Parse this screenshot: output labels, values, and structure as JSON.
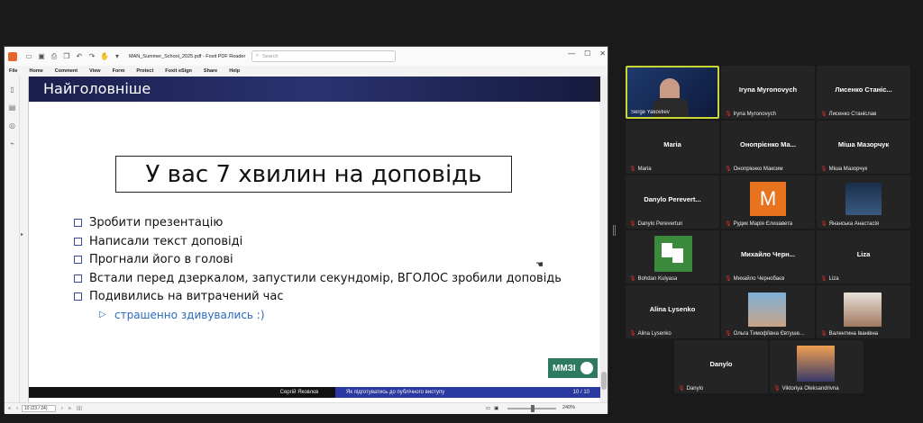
{
  "foxit": {
    "title": "MAN_Summer_School_2025.pdf - Foxit PDF Reader",
    "search_placeholder": "Search",
    "menu": [
      "File",
      "Home",
      "Comment",
      "View",
      "Form",
      "Protect",
      "Foxit eSign",
      "Share",
      "Help"
    ],
    "status": {
      "page_field": "10 (23 / 24)",
      "zoom": "240%"
    }
  },
  "slide": {
    "title": "Найголовніше",
    "heading": "У вас 7 хвилин на доповідь",
    "bullets": [
      "Зробити презентацію",
      "Написали текст доповіді",
      "Прогнали його в голові",
      "Встали перед дзеркалом, запустили секундомір, ВГОЛОС зробили доповідь",
      "Подивились на витрачений час"
    ],
    "sub_bullet": "страшенно здивувались :)",
    "logo_text": "ММЗІ",
    "footer": {
      "author": "Сергій Яковлєв",
      "talk": "Як підготуватись до публічного виступу",
      "page": "10 / 10"
    }
  },
  "participants": [
    {
      "name": "Serge Yakovliev",
      "big": "",
      "muted": false,
      "active": true
    },
    {
      "name": "Iryna Myronovych",
      "big": "Iryna Myronovych",
      "muted": true
    },
    {
      "name": "Лисенко Станіслав",
      "big": "Лисенко Станіс...",
      "muted": true
    },
    {
      "name": "Maria",
      "big": "Maria",
      "muted": true
    },
    {
      "name": "Онопрієнко Максим",
      "big": "Онопрієнко Ма...",
      "muted": true
    },
    {
      "name": "Міша Мазорчук",
      "big": "Міша Мазорчук",
      "muted": true
    },
    {
      "name": "Danylo Perevertun",
      "big": "Danylo Perevert...",
      "muted": true
    },
    {
      "name": "Рудик Марія Єлизавета",
      "big": "",
      "avatar_letter": "M",
      "muted": true
    },
    {
      "name": "Янанська Анастасія",
      "big": "",
      "muted": true
    },
    {
      "name": "Bohdan Kulyasa",
      "big": "",
      "muted": true
    },
    {
      "name": "Михайло Чернобаєв",
      "big": "Михайло Черн...",
      "muted": true
    },
    {
      "name": "Liza",
      "big": "Liza",
      "muted": true
    },
    {
      "name": "Alina Lysenko",
      "big": "Alina Lysenko",
      "muted": true
    },
    {
      "name": "Ольга Тимофіївна Євтуше...",
      "big": "",
      "muted": true
    },
    {
      "name": "Валентина Іванівна",
      "big": "",
      "muted": true
    },
    {
      "name": "Danylo",
      "big": "Danylo",
      "muted": true
    },
    {
      "name": "Viktoriya Oleksandrivna",
      "big": "",
      "muted": true
    }
  ],
  "colors": {
    "active_speaker_border": "#c9d634",
    "avatar_orange": "#e8731e",
    "slide_blue": "#2b3aa0",
    "logo_green": "#2e7a5e"
  }
}
